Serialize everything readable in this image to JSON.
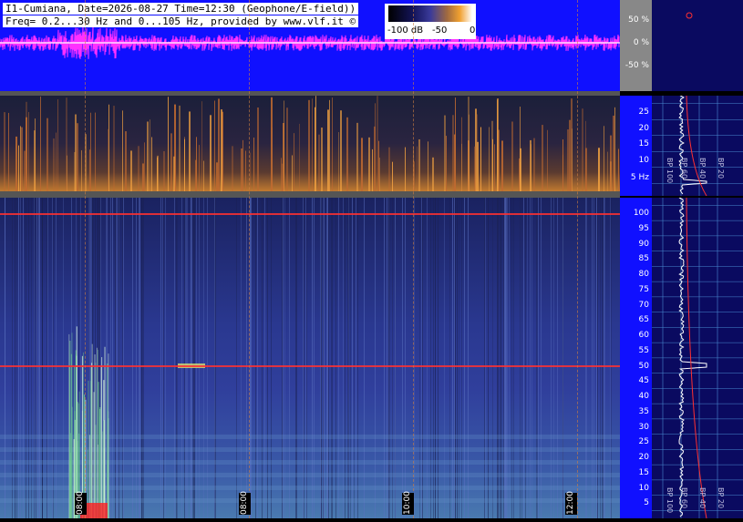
{
  "header": {
    "line1": "I1-Cumiana, Date=2026-08-27 Time=12:30 (Geophone/E-field))",
    "line2": "Freq= 0.2...30 Hz and 0...105 Hz, provided by www.vlf.it ©"
  },
  "colorbar": {
    "labels": [
      "-100 dB",
      "-50",
      "0"
    ]
  },
  "waveform_axis": [
    "50 %",
    "0 %",
    "-50 %"
  ],
  "low_axis": [
    "25",
    "20",
    "15",
    "10",
    "5 Hz"
  ],
  "high_axis": [
    "100",
    "95",
    "90",
    "85",
    "80",
    "75",
    "70",
    "65",
    "60",
    "55",
    "50",
    "45",
    "40",
    "35",
    "30",
    "25",
    "20",
    "15",
    "10",
    "5"
  ],
  "side_labels_low": [
    "BP 100",
    "BP 60",
    "BP 40",
    "BP 20"
  ],
  "side_labels_high": [
    "BP 100",
    "BP 60",
    "BP 40",
    "BP 20"
  ],
  "time_labels": [
    "08:00",
    "08:00",
    "10:00",
    "12:00"
  ],
  "colors": {
    "wave_bg": "#1010ff",
    "wave_trace": "#ff30ff",
    "accent_red": "#ff3030",
    "grid": "#4a8ad0"
  }
}
